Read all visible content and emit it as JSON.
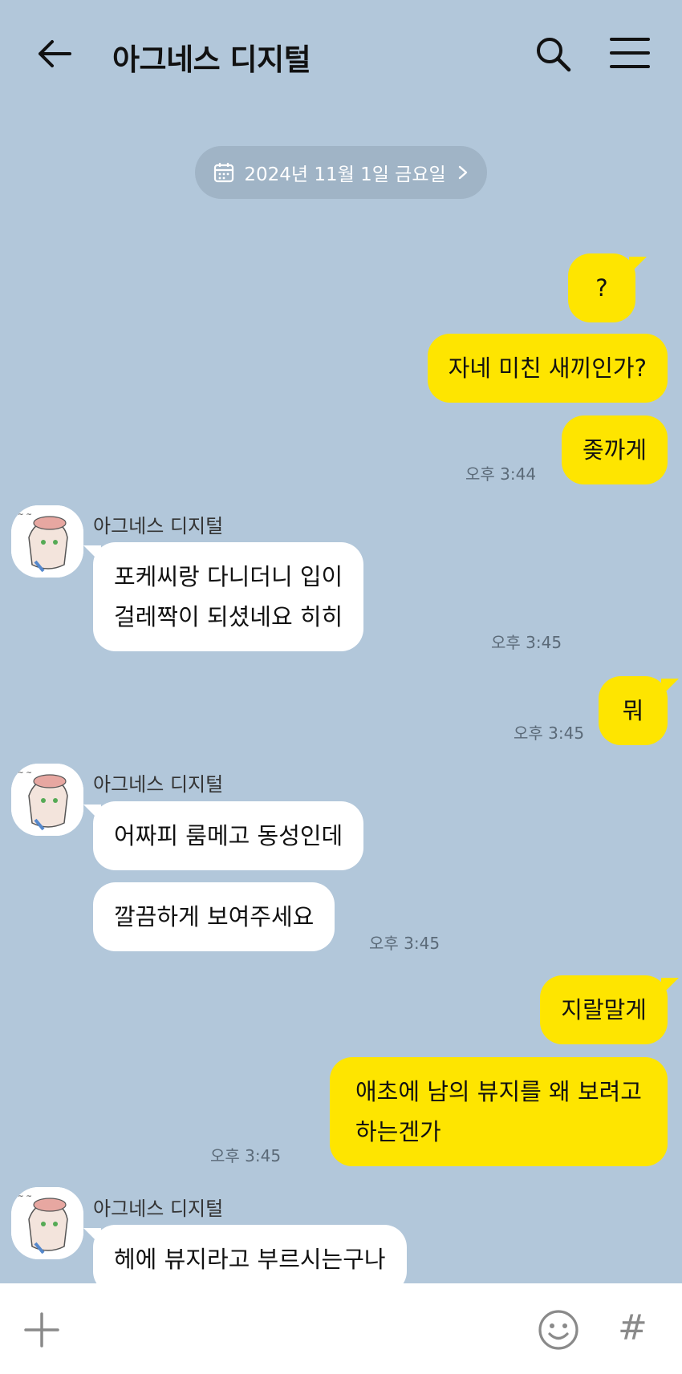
{
  "header": {
    "title": "아그네스 디지털"
  },
  "date_divider": {
    "label": "2024년 11월 1일 금요일"
  },
  "messages": [
    {
      "side": "me",
      "text": "?"
    },
    {
      "side": "me",
      "text": "자네 미친 새끼인가?"
    },
    {
      "side": "me",
      "text": "좆까게",
      "time": "오후 3:44"
    },
    {
      "side": "them",
      "sender": "아그네스 디지털",
      "lines": [
        "포케씨랑 다니더니 입이",
        "걸레짝이 되셨네요 히히"
      ],
      "time": "오후 3:45"
    },
    {
      "side": "me",
      "text": "뭐",
      "time": "오후 3:45"
    },
    {
      "side": "them",
      "sender": "아그네스 디지털",
      "text": "어짜피 룸메고 동성인데"
    },
    {
      "side": "them",
      "text": "깔끔하게 보여주세요",
      "time": "오후 3:45"
    },
    {
      "side": "me",
      "text": "지랄말게"
    },
    {
      "side": "me",
      "lines": [
        "애초에 남의 뷰지를 왜 보려고",
        "하는겐가"
      ],
      "time": "오후 3:45"
    },
    {
      "side": "them",
      "sender": "아그네스 디지털",
      "text": "헤에 뷰지라고 부르시는구나"
    }
  ],
  "composer": {
    "hash_label": "#"
  },
  "colors": {
    "background": "#b2c7da",
    "my_bubble": "#fee500",
    "their_bubble": "#ffffff"
  }
}
